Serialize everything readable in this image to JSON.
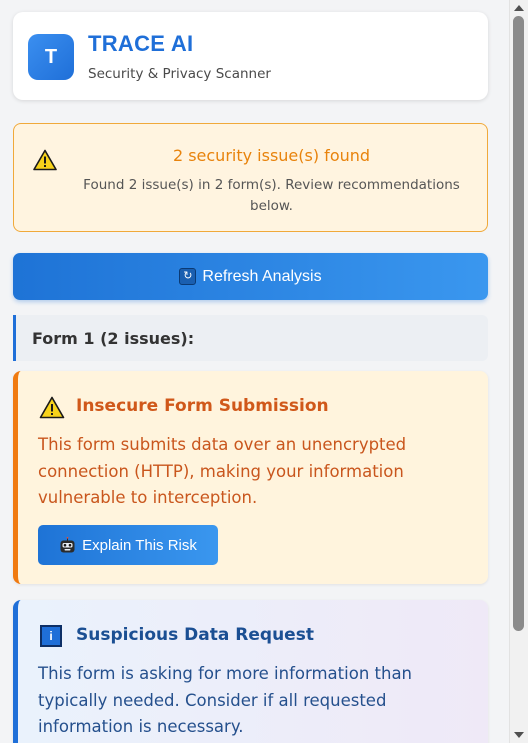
{
  "header": {
    "logo_letter": "T",
    "title": "TRACE AI",
    "subtitle": "Security & Privacy Scanner"
  },
  "summary": {
    "icon": "warning-icon",
    "title": "2 security issue(s) found",
    "description": "Found 2 issue(s) in 2 form(s). Review recommendations below."
  },
  "refresh_button": {
    "icon": "refresh-icon",
    "label": "Refresh Analysis"
  },
  "forms": [
    {
      "heading": "Form 1 (2 issues):",
      "issues": [
        {
          "severity": "warning",
          "icon": "warning-icon",
          "title": "Insecure Form Submission",
          "description": "This form submits data over an unencrypted connection (HTTP), making your information vulnerable to interception.",
          "button_icon": "robot-icon",
          "button_label": "Explain This Risk"
        },
        {
          "severity": "info",
          "icon": "info-icon",
          "icon_glyph": "i",
          "title": "Suspicious Data Request",
          "description": "This form is asking for more information than typically needed. Consider if all requested information is necessary."
        }
      ]
    }
  ],
  "colors": {
    "brand": "#1f6fd8",
    "warning": "#f07a10",
    "warning_text": "#d0581a",
    "alert_title": "#e8830c",
    "info_text": "#1b4f93"
  }
}
